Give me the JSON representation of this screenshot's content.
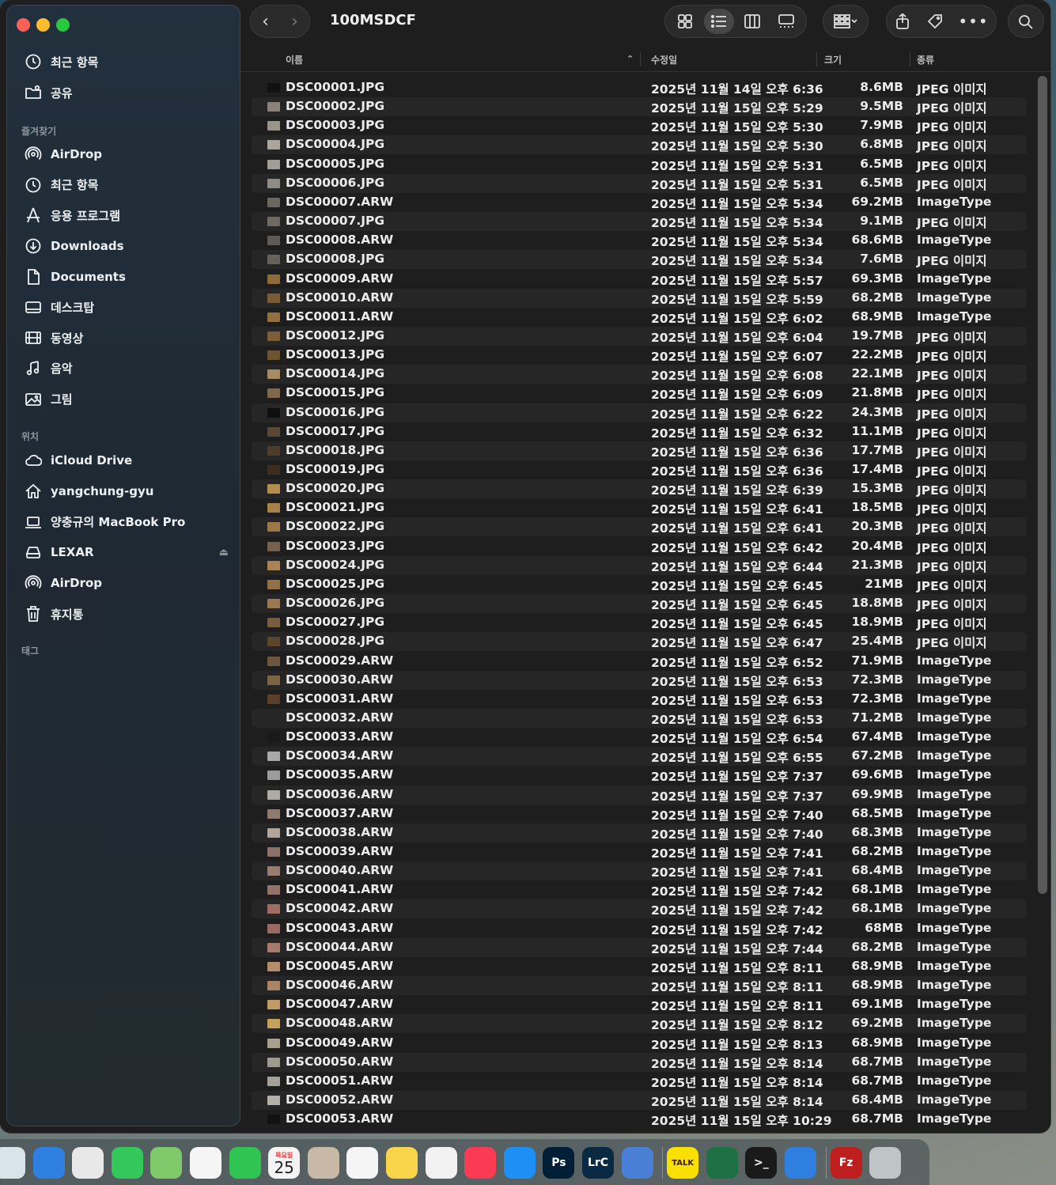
{
  "window": {
    "title": "100MSDCF"
  },
  "toolbar": {
    "back": "‹",
    "forward": "›",
    "more": "•••"
  },
  "sidebar": {
    "top": [
      {
        "label": "최근 항목",
        "icon": "clock-icon"
      },
      {
        "label": "공유",
        "icon": "shared-folder-icon"
      }
    ],
    "favorites_title": "즐겨찾기",
    "favorites": [
      {
        "label": "AirDrop",
        "icon": "airdrop-icon"
      },
      {
        "label": "최근 항목",
        "icon": "clock-icon"
      },
      {
        "label": "응용 프로그램",
        "icon": "applications-icon"
      },
      {
        "label": "Downloads",
        "icon": "download-icon"
      },
      {
        "label": "Documents",
        "icon": "document-icon"
      },
      {
        "label": "데스크탑",
        "icon": "desktop-icon"
      },
      {
        "label": "동영상",
        "icon": "film-icon"
      },
      {
        "label": "음악",
        "icon": "music-icon"
      },
      {
        "label": "그림",
        "icon": "picture-icon"
      }
    ],
    "locations_title": "위치",
    "locations": [
      {
        "label": "iCloud Drive",
        "icon": "cloud-icon"
      },
      {
        "label": "yangchung-gyu",
        "icon": "home-icon"
      },
      {
        "label": "양충규의 MacBook Pro",
        "icon": "laptop-icon"
      },
      {
        "label": "LEXAR",
        "icon": "drive-icon"
      },
      {
        "label": "AirDrop",
        "icon": "airdrop-icon"
      },
      {
        "label": "휴지통",
        "icon": "trash-icon"
      }
    ],
    "tags_title": "태그"
  },
  "columns": {
    "name": "이름",
    "date": "수정일",
    "size": "크기",
    "kind": "종류"
  },
  "files": [
    {
      "name": "DSC00001.JPG",
      "date": "2025년 11월 14일 오후 6:36",
      "size": "8.6MB",
      "kind": "JPEG 이미지"
    },
    {
      "name": "DSC00002.JPG",
      "date": "2025년 11월 15일 오후 5:29",
      "size": "9.5MB",
      "kind": "JPEG 이미지"
    },
    {
      "name": "DSC00003.JPG",
      "date": "2025년 11월 15일 오후 5:30",
      "size": "7.9MB",
      "kind": "JPEG 이미지"
    },
    {
      "name": "DSC00004.JPG",
      "date": "2025년 11월 15일 오후 5:30",
      "size": "6.8MB",
      "kind": "JPEG 이미지"
    },
    {
      "name": "DSC00005.JPG",
      "date": "2025년 11월 15일 오후 5:31",
      "size": "6.5MB",
      "kind": "JPEG 이미지"
    },
    {
      "name": "DSC00006.JPG",
      "date": "2025년 11월 15일 오후 5:31",
      "size": "6.5MB",
      "kind": "JPEG 이미지"
    },
    {
      "name": "DSC00007.ARW",
      "date": "2025년 11월 15일 오후 5:34",
      "size": "69.2MB",
      "kind": "ImageType"
    },
    {
      "name": "DSC00007.JPG",
      "date": "2025년 11월 15일 오후 5:34",
      "size": "9.1MB",
      "kind": "JPEG 이미지"
    },
    {
      "name": "DSC00008.ARW",
      "date": "2025년 11월 15일 오후 5:34",
      "size": "68.6MB",
      "kind": "ImageType"
    },
    {
      "name": "DSC00008.JPG",
      "date": "2025년 11월 15일 오후 5:34",
      "size": "7.6MB",
      "kind": "JPEG 이미지"
    },
    {
      "name": "DSC00009.ARW",
      "date": "2025년 11월 15일 오후 5:57",
      "size": "69.3MB",
      "kind": "ImageType"
    },
    {
      "name": "DSC00010.ARW",
      "date": "2025년 11월 15일 오후 5:59",
      "size": "68.2MB",
      "kind": "ImageType"
    },
    {
      "name": "DSC00011.ARW",
      "date": "2025년 11월 15일 오후 6:02",
      "size": "68.9MB",
      "kind": "ImageType"
    },
    {
      "name": "DSC00012.JPG",
      "date": "2025년 11월 15일 오후 6:04",
      "size": "19.7MB",
      "kind": "JPEG 이미지"
    },
    {
      "name": "DSC00013.JPG",
      "date": "2025년 11월 15일 오후 6:07",
      "size": "22.2MB",
      "kind": "JPEG 이미지"
    },
    {
      "name": "DSC00014.JPG",
      "date": "2025년 11월 15일 오후 6:08",
      "size": "22.1MB",
      "kind": "JPEG 이미지"
    },
    {
      "name": "DSC00015.JPG",
      "date": "2025년 11월 15일 오후 6:09",
      "size": "21.8MB",
      "kind": "JPEG 이미지"
    },
    {
      "name": "DSC00016.JPG",
      "date": "2025년 11월 15일 오후 6:22",
      "size": "24.3MB",
      "kind": "JPEG 이미지"
    },
    {
      "name": "DSC00017.JPG",
      "date": "2025년 11월 15일 오후 6:32",
      "size": "11.1MB",
      "kind": "JPEG 이미지"
    },
    {
      "name": "DSC00018.JPG",
      "date": "2025년 11월 15일 오후 6:36",
      "size": "17.7MB",
      "kind": "JPEG 이미지"
    },
    {
      "name": "DSC00019.JPG",
      "date": "2025년 11월 15일 오후 6:36",
      "size": "17.4MB",
      "kind": "JPEG 이미지"
    },
    {
      "name": "DSC00020.JPG",
      "date": "2025년 11월 15일 오후 6:39",
      "size": "15.3MB",
      "kind": "JPEG 이미지"
    },
    {
      "name": "DSC00021.JPG",
      "date": "2025년 11월 15일 오후 6:41",
      "size": "18.5MB",
      "kind": "JPEG 이미지"
    },
    {
      "name": "DSC00022.JPG",
      "date": "2025년 11월 15일 오후 6:41",
      "size": "20.3MB",
      "kind": "JPEG 이미지"
    },
    {
      "name": "DSC00023.JPG",
      "date": "2025년 11월 15일 오후 6:42",
      "size": "20.4MB",
      "kind": "JPEG 이미지"
    },
    {
      "name": "DSC00024.JPG",
      "date": "2025년 11월 15일 오후 6:44",
      "size": "21.3MB",
      "kind": "JPEG 이미지"
    },
    {
      "name": "DSC00025.JPG",
      "date": "2025년 11월 15일 오후 6:45",
      "size": "21MB",
      "kind": "JPEG 이미지"
    },
    {
      "name": "DSC00026.JPG",
      "date": "2025년 11월 15일 오후 6:45",
      "size": "18.8MB",
      "kind": "JPEG 이미지"
    },
    {
      "name": "DSC00027.JPG",
      "date": "2025년 11월 15일 오후 6:45",
      "size": "18.9MB",
      "kind": "JPEG 이미지"
    },
    {
      "name": "DSC00028.JPG",
      "date": "2025년 11월 15일 오후 6:47",
      "size": "25.4MB",
      "kind": "JPEG 이미지"
    },
    {
      "name": "DSC00029.ARW",
      "date": "2025년 11월 15일 오후 6:52",
      "size": "71.9MB",
      "kind": "ImageType"
    },
    {
      "name": "DSC00030.ARW",
      "date": "2025년 11월 15일 오후 6:53",
      "size": "72.3MB",
      "kind": "ImageType"
    },
    {
      "name": "DSC00031.ARW",
      "date": "2025년 11월 15일 오후 6:53",
      "size": "72.3MB",
      "kind": "ImageType"
    },
    {
      "name": "DSC00032.ARW",
      "date": "2025년 11월 15일 오후 6:53",
      "size": "71.2MB",
      "kind": "ImageType"
    },
    {
      "name": "DSC00033.ARW",
      "date": "2025년 11월 15일 오후 6:54",
      "size": "67.4MB",
      "kind": "ImageType"
    },
    {
      "name": "DSC00034.ARW",
      "date": "2025년 11월 15일 오후 6:55",
      "size": "67.2MB",
      "kind": "ImageType"
    },
    {
      "name": "DSC00035.ARW",
      "date": "2025년 11월 15일 오후 7:37",
      "size": "69.6MB",
      "kind": "ImageType"
    },
    {
      "name": "DSC00036.ARW",
      "date": "2025년 11월 15일 오후 7:37",
      "size": "69.9MB",
      "kind": "ImageType"
    },
    {
      "name": "DSC00037.ARW",
      "date": "2025년 11월 15일 오후 7:40",
      "size": "68.5MB",
      "kind": "ImageType"
    },
    {
      "name": "DSC00038.ARW",
      "date": "2025년 11월 15일 오후 7:40",
      "size": "68.3MB",
      "kind": "ImageType"
    },
    {
      "name": "DSC00039.ARW",
      "date": "2025년 11월 15일 오후 7:41",
      "size": "68.2MB",
      "kind": "ImageType"
    },
    {
      "name": "DSC00040.ARW",
      "date": "2025년 11월 15일 오후 7:41",
      "size": "68.4MB",
      "kind": "ImageType"
    },
    {
      "name": "DSC00041.ARW",
      "date": "2025년 11월 15일 오후 7:42",
      "size": "68.1MB",
      "kind": "ImageType"
    },
    {
      "name": "DSC00042.ARW",
      "date": "2025년 11월 15일 오후 7:42",
      "size": "68.1MB",
      "kind": "ImageType"
    },
    {
      "name": "DSC00043.ARW",
      "date": "2025년 11월 15일 오후 7:42",
      "size": "68MB",
      "kind": "ImageType"
    },
    {
      "name": "DSC00044.ARW",
      "date": "2025년 11월 15일 오후 7:44",
      "size": "68.2MB",
      "kind": "ImageType"
    },
    {
      "name": "DSC00045.ARW",
      "date": "2025년 11월 15일 오후 8:11",
      "size": "68.9MB",
      "kind": "ImageType"
    },
    {
      "name": "DSC00046.ARW",
      "date": "2025년 11월 15일 오후 8:11",
      "size": "68.9MB",
      "kind": "ImageType"
    },
    {
      "name": "DSC00047.ARW",
      "date": "2025년 11월 15일 오후 8:11",
      "size": "69.1MB",
      "kind": "ImageType"
    },
    {
      "name": "DSC00048.ARW",
      "date": "2025년 11월 15일 오후 8:12",
      "size": "69.2MB",
      "kind": "ImageType"
    },
    {
      "name": "DSC00049.ARW",
      "date": "2025년 11월 15일 오후 8:13",
      "size": "68.9MB",
      "kind": "ImageType"
    },
    {
      "name": "DSC00050.ARW",
      "date": "2025년 11월 15일 오후 8:14",
      "size": "68.7MB",
      "kind": "ImageType"
    },
    {
      "name": "DSC00051.ARW",
      "date": "2025년 11월 15일 오후 8:14",
      "size": "68.7MB",
      "kind": "ImageType"
    },
    {
      "name": "DSC00052.ARW",
      "date": "2025년 11월 15일 오후 8:14",
      "size": "68.4MB",
      "kind": "ImageType"
    },
    {
      "name": "DSC00053.ARW",
      "date": "2025년 11월 15일 오후 10:29",
      "size": "68.7MB",
      "kind": "ImageType"
    }
  ],
  "thumb_colors": [
    "#111111",
    "#8a8278",
    "#9a948a",
    "#aaa59d",
    "#a39f98",
    "#8f8b85",
    "#6b6660",
    "#6f6963",
    "#5e5a55",
    "#66615b",
    "#8c6a3a",
    "#7a5b34",
    "#93703f",
    "#7d5e37",
    "#6e5330",
    "#a58b62",
    "#80694a",
    "#0f0f0f",
    "#5a4836",
    "#4e3c2a",
    "#3c2e22",
    "#b58c50",
    "#a68149",
    "#9b7a47",
    "#74604c",
    "#a88452",
    "#93704a",
    "#9a7851",
    "#785c3e",
    "#5c452d",
    "#6d563b",
    "#7e6546",
    "#5a4026",
    "#262626",
    "#1a1a1a",
    "#a8a8a8",
    "#9c9c9c",
    "#b0aaa4",
    "#8f7a70",
    "#b0a49b",
    "#8a7268",
    "#9a7c6f",
    "#93726a",
    "#a06d64",
    "#9a6a62",
    "#a67b6b",
    "#b48e6a",
    "#a98565",
    "#c19a64",
    "#c4a25c",
    "#a7a08e",
    "#9e9a8f",
    "#a4a09a",
    "#b4b0aa"
  ],
  "dock": {
    "calendar_month": "목요일",
    "calendar_day": "25",
    "apps": [
      {
        "name": "launchpad-icon",
        "color": "#d8e3ea",
        "label": ""
      },
      {
        "name": "safari-icon",
        "color": "#2f7fe0",
        "label": ""
      },
      {
        "name": "chrome-icon",
        "color": "#e8e8e8",
        "label": ""
      },
      {
        "name": "messages-icon",
        "color": "#34c759",
        "label": ""
      },
      {
        "name": "maps-icon",
        "color": "#7fc96b",
        "label": ""
      },
      {
        "name": "photos-icon",
        "color": "#f5f5f5",
        "label": ""
      },
      {
        "name": "facetime-icon",
        "color": "#30c452",
        "label": ""
      },
      {
        "name": "calendar-icon",
        "color": "#f4f4f4",
        "label": ""
      },
      {
        "name": "contacts-icon",
        "color": "#c8b9a6",
        "label": ""
      },
      {
        "name": "reminders-icon",
        "color": "#f5f5f5",
        "label": ""
      },
      {
        "name": "notes-icon",
        "color": "#f7d44a",
        "label": ""
      },
      {
        "name": "freeform-icon",
        "color": "#f2f2f2",
        "label": ""
      },
      {
        "name": "music-app-icon",
        "color": "#fa3b53",
        "label": ""
      },
      {
        "name": "app-store-icon",
        "color": "#1e8ff5",
        "label": ""
      },
      {
        "name": "photoshop-icon",
        "color": "#001e36",
        "label": "Ps"
      },
      {
        "name": "lightroom-classic-icon",
        "color": "#0a2a43",
        "label": "LrC"
      },
      {
        "name": "simulator-icon",
        "color": "#4a7fd6",
        "label": ""
      },
      {
        "name": "kakaotalk-icon",
        "color": "#f9e000",
        "label": "TALK"
      },
      {
        "name": "excel-icon",
        "color": "#1e7145",
        "label": ""
      },
      {
        "name": "terminal-icon",
        "color": "#1a1a1a",
        "label": ">_"
      },
      {
        "name": "safari-2-icon",
        "color": "#2f7fe0",
        "label": ""
      },
      {
        "name": "filezilla-icon",
        "color": "#bf1e1e",
        "label": "Fz"
      },
      {
        "name": "trash-dock-icon",
        "color": "#bfc4c6",
        "label": ""
      }
    ]
  }
}
